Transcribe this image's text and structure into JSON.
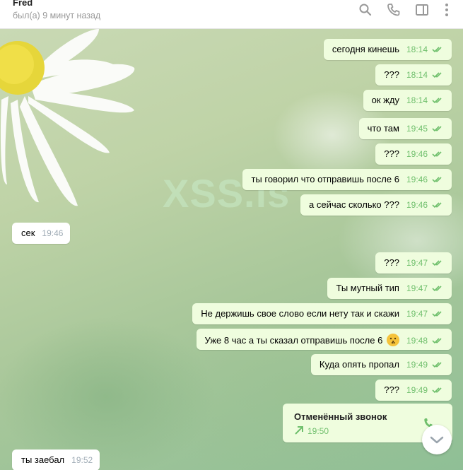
{
  "header": {
    "name": "Fred",
    "status": "был(а) 9 минут назад",
    "icons": [
      "search-icon",
      "phone-icon",
      "sidebar-icon",
      "more-icon"
    ]
  },
  "watermark": "XSS.is",
  "messages": [
    {
      "dir": "out",
      "text": "сегодня кинешь",
      "time": "18:14"
    },
    {
      "dir": "out",
      "text": "???",
      "time": "18:14"
    },
    {
      "dir": "out",
      "text": "ок жду",
      "time": "18:14"
    },
    {
      "dir": "out",
      "text": "что там",
      "time": "19:45"
    },
    {
      "dir": "out",
      "text": "???",
      "time": "19:46"
    },
    {
      "dir": "out",
      "text": "ты  говорил что отправишь после 6",
      "time": "19:46"
    },
    {
      "dir": "out",
      "text": "а сейчас сколько ???",
      "time": "19:46"
    },
    {
      "dir": "in",
      "text": "сек",
      "time": "19:46"
    },
    {
      "dir": "out",
      "text": "???",
      "time": "19:47"
    },
    {
      "dir": "out",
      "text": "Ты мутный тип",
      "time": "19:47"
    },
    {
      "dir": "out",
      "text": "Не держишь свое слово если нету так и скажи",
      "time": "19:47"
    },
    {
      "dir": "out",
      "text": "Уже 8 час а ты сказал отправишь после 6",
      "time": "19:48",
      "emoji": "face-with-hand-over-mouth"
    },
    {
      "dir": "out",
      "text": "Куда опять пропал",
      "time": "19:49"
    },
    {
      "dir": "out",
      "text": "???",
      "time": "19:49"
    }
  ],
  "call": {
    "title": "Отменённый звонок",
    "time": "19:50"
  },
  "last_incoming": {
    "text": "ты заебал",
    "time": "19:52"
  },
  "colors": {
    "outgoing_bubble": "#effdde",
    "accent_green": "#6fbf6c",
    "header_bg": "#ffffff"
  }
}
